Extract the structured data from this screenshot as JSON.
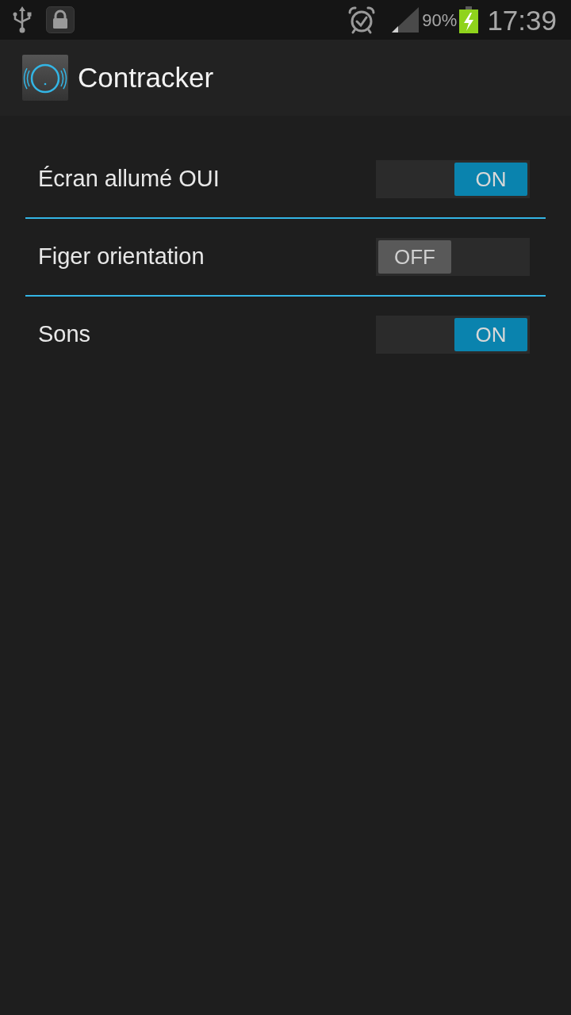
{
  "status_bar": {
    "battery": "90%",
    "time": "17:39"
  },
  "app_bar": {
    "title": "Contracker"
  },
  "settings": [
    {
      "label": "Écran allumé OUI",
      "on": true,
      "thumb_text": "ON"
    },
    {
      "label": "Figer orientation",
      "on": false,
      "thumb_text": "OFF"
    },
    {
      "label": "Sons",
      "on": true,
      "thumb_text": "ON"
    }
  ]
}
